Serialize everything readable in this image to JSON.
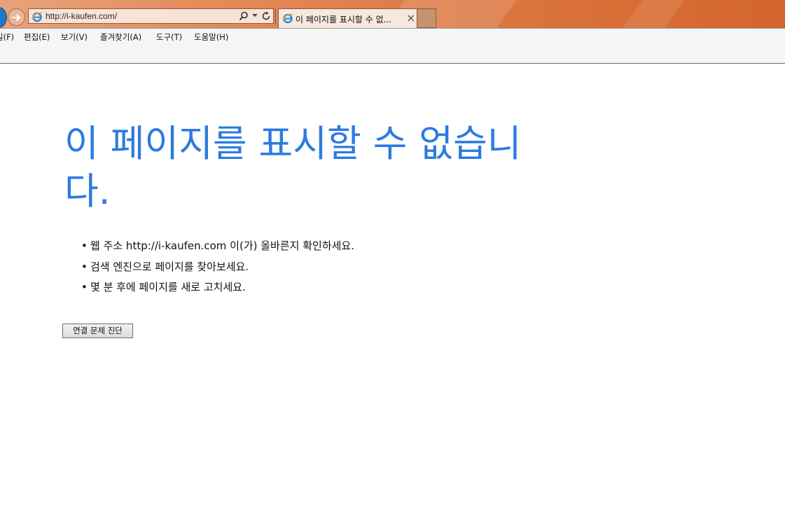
{
  "browser": {
    "address_url": "http://i-kaufen.com/",
    "tab_title": "이 페이지를 표시할 수 없...",
    "tab_close": "×",
    "icons": {
      "back": "back-arrow-icon",
      "forward": "forward-arrow-icon",
      "page": "ie-logo-icon",
      "search": "search-icon",
      "dropdown": "chevron-down-icon",
      "refresh": "refresh-icon"
    }
  },
  "menu": {
    "items": [
      "일(F)",
      "편집(E)",
      "보기(V)",
      "즐겨찾기(A)",
      "도구(T)",
      "도움말(H)"
    ]
  },
  "content": {
    "title": "이 페이지를 표시할 수 없습니다.",
    "suggestions": [
      "웹 주소 http://i-kaufen.com 이(가) 올바른지 확인하세요.",
      "검색 엔진으로 페이지를 찾아보세요.",
      "몇 분 후에 페이지를 새로 고치세요."
    ],
    "bullet": "•",
    "diagnose_button": "연결 문제 진단"
  },
  "colors": {
    "title_blue": "#2c7be0",
    "frame_orange": "#dd7a45"
  }
}
